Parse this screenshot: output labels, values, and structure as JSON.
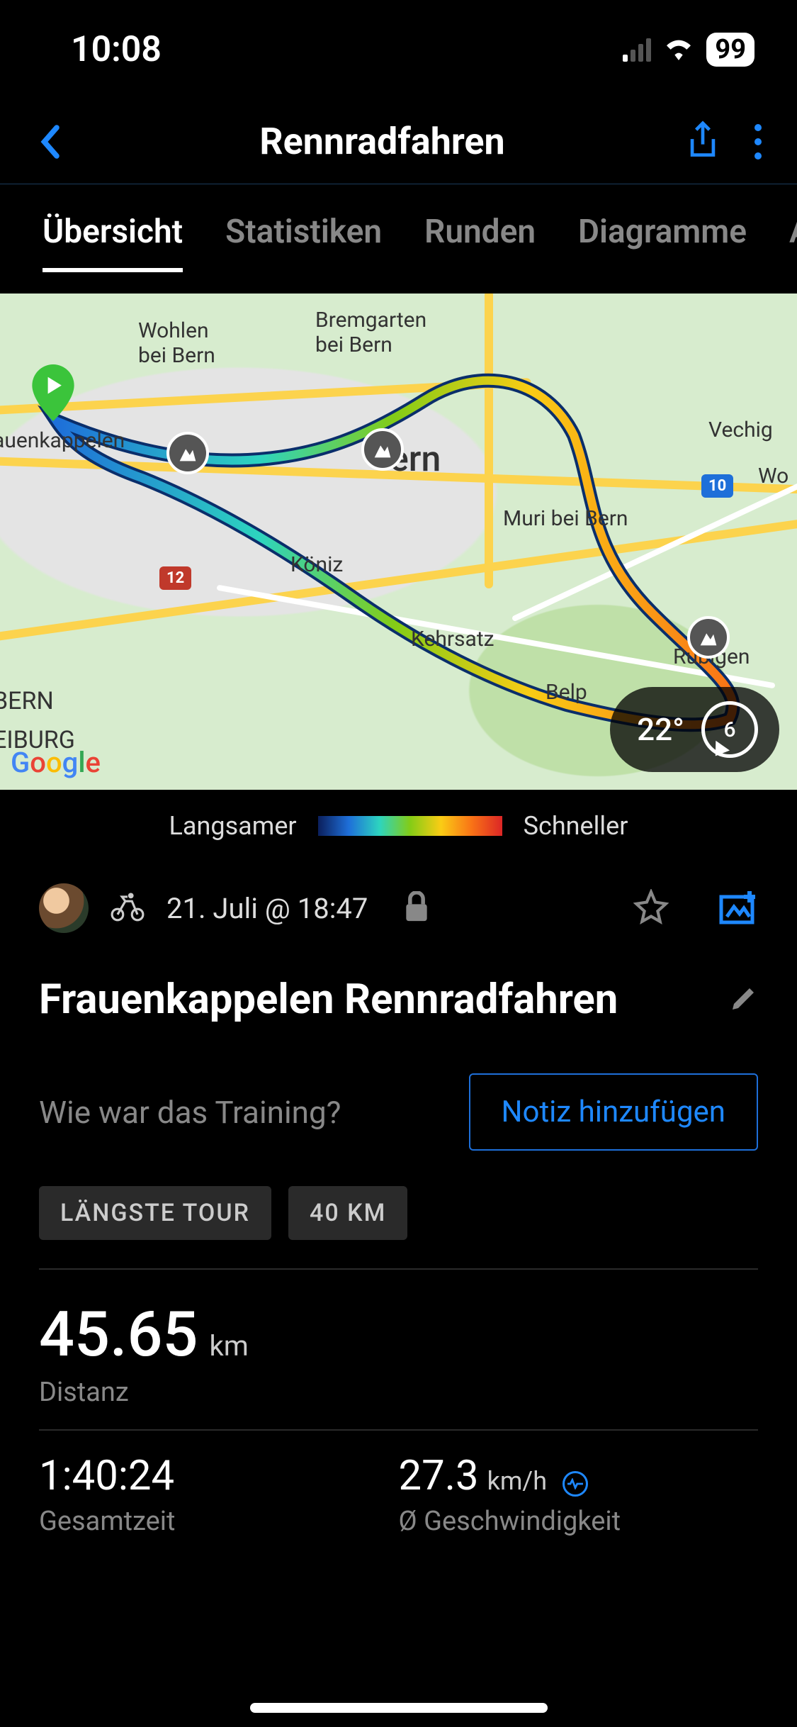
{
  "status": {
    "time": "10:08",
    "battery": "99"
  },
  "header": {
    "title": "Rennradfahren"
  },
  "tabs": [
    "Übersicht",
    "Statistiken",
    "Runden",
    "Diagramme",
    "Ausr"
  ],
  "map": {
    "labels": {
      "wohlen": "Wohlen\nbei Bern",
      "bremgarten": "Bremgarten\nbei Bern",
      "bern": "ern",
      "muri": "Muri bei Bern",
      "koniz": "Köniz",
      "kehrsatz": "Kehrsatz",
      "belp": "Belp",
      "rubigen": "Rubigen",
      "vechig": "Vechig",
      "wo": "Wo",
      "frauenkappelen": "auenkappelen",
      "bern_canton": "BERN",
      "eiburg": "EIBURG"
    },
    "shields": {
      "r12": "12",
      "r10": "10"
    },
    "attribution": "Google",
    "weather": {
      "temp": "22°",
      "wind": "6"
    }
  },
  "legend": {
    "slower": "Langsamer",
    "faster": "Schneller"
  },
  "activity": {
    "datetime": "21. Juli @ 18:47",
    "title": "Frauenkappelen Rennradfahren",
    "note_prompt": "Wie war das Training?",
    "note_button": "Notiz hinzufügen",
    "badges": [
      "LÄNGSTE TOUR",
      "40 KM"
    ]
  },
  "stats": {
    "distance": {
      "value": "45.65",
      "unit": "km",
      "label": "Distanz"
    },
    "time": {
      "value": "1:40:24",
      "label": "Gesamtzeit"
    },
    "speed": {
      "value": "27.3",
      "unit": "km/h",
      "label": "Ø Geschwindigkeit"
    }
  }
}
